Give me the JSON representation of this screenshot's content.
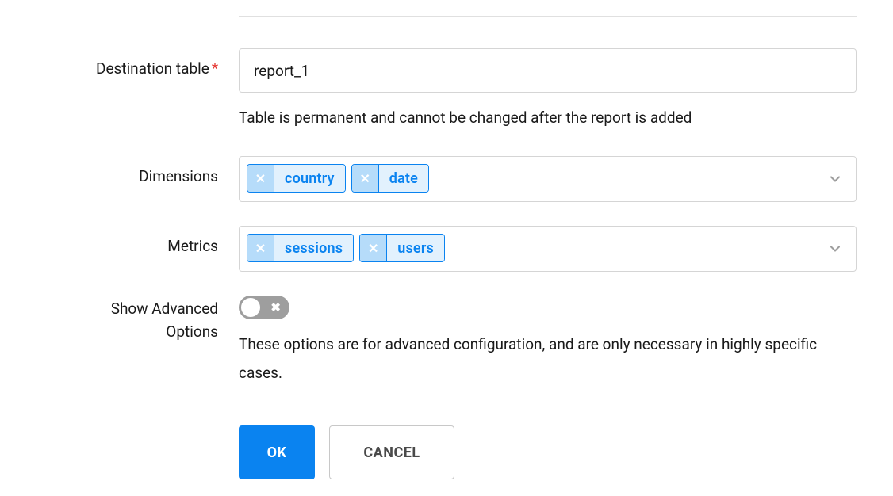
{
  "fields": {
    "destination_table": {
      "label": "Destination table",
      "required_mark": "*",
      "value": "report_1",
      "helper": "Table is permanent and cannot be changed after the report is added"
    },
    "dimensions": {
      "label": "Dimensions",
      "tags": [
        {
          "label": "country"
        },
        {
          "label": "date"
        }
      ]
    },
    "metrics": {
      "label": "Metrics",
      "tags": [
        {
          "label": "sessions"
        },
        {
          "label": "users"
        }
      ]
    },
    "advanced": {
      "label": "Show Advanced Options",
      "helper": "These options are for advanced configuration, and are only necessary in highly specific cases."
    }
  },
  "buttons": {
    "ok": "OK",
    "cancel": "CANCEL"
  },
  "icons": {
    "tag_remove": "✕",
    "toggle_x": "✖"
  }
}
